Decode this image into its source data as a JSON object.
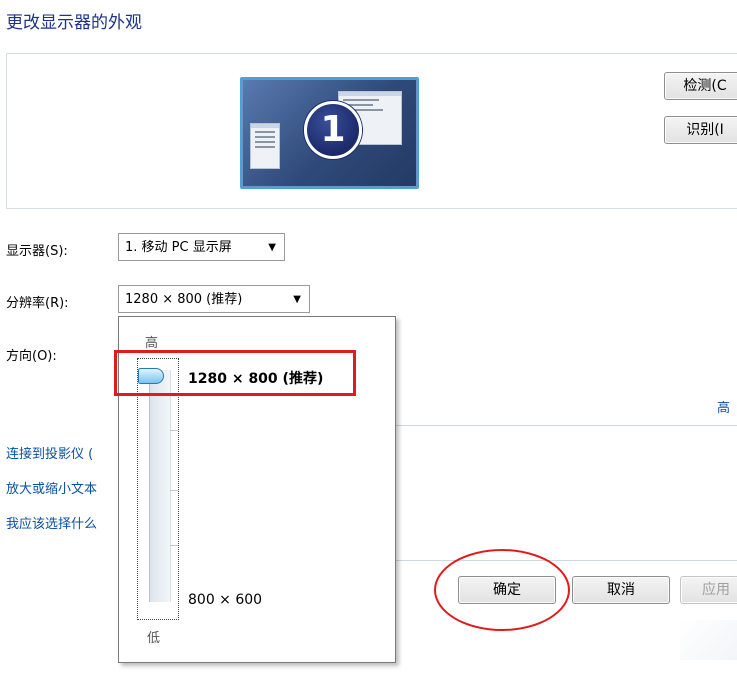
{
  "page": {
    "title": "更改显示器的外观"
  },
  "preview": {
    "monitor_number": "1"
  },
  "buttons": {
    "detect": "检测(C",
    "identify": "识别(I",
    "ok": "确定",
    "cancel": "取消",
    "apply": "应用"
  },
  "fields": {
    "display_label": "显示器(S):",
    "display_value": "1. 移动 PC 显示屏",
    "resolution_label": "分辨率(R):",
    "resolution_value": "1280 × 800 (推荐)",
    "orientation_label": "方向(O):"
  },
  "resolution_dropdown": {
    "high_label": "高",
    "low_label": "低",
    "top_value": "1280 × 800 (推荐)",
    "bottom_value": "800 × 600",
    "slider_position": 1.0
  },
  "advanced_link": "高",
  "links": [
    "连接到投影仪 (",
    "放大或缩小文本",
    "我应该选择什么"
  ],
  "colors": {
    "title": "#1e3287",
    "link": "#0b4fa5",
    "annotation": "#e11b1b"
  }
}
